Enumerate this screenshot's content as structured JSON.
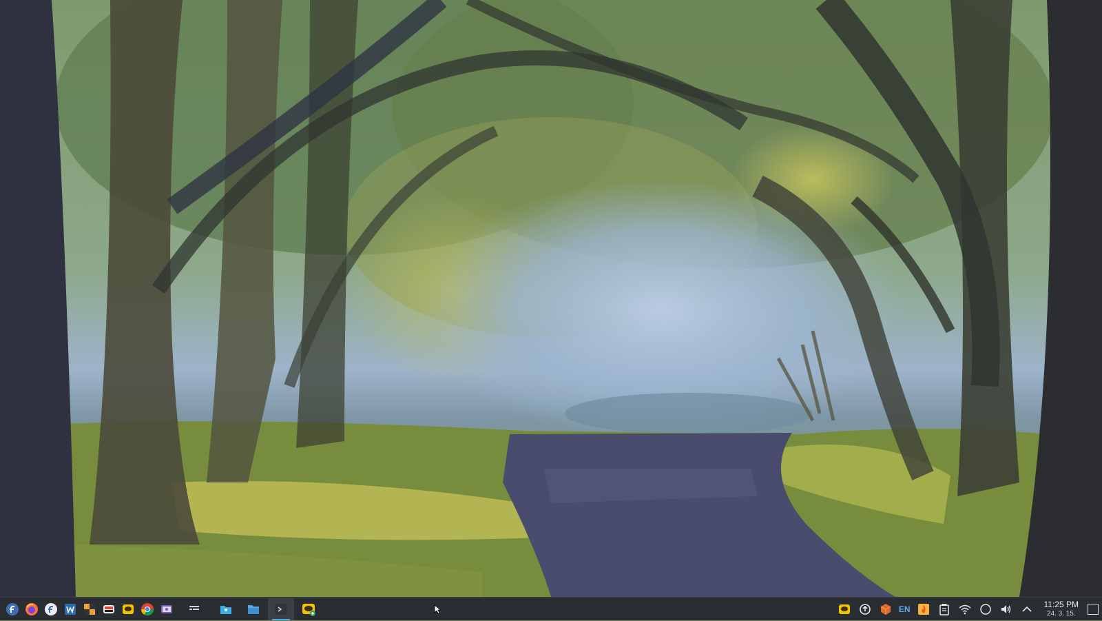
{
  "desktop": {
    "wallpaper": "painted-forest-path"
  },
  "taskbar": {
    "launchers": [
      {
        "name": "fedora-icon",
        "color": "#3c6eb4"
      },
      {
        "name": "firefox-icon",
        "color": "#ff7139"
      },
      {
        "name": "fedora-media-writer-icon",
        "color": "#6aa0d8"
      },
      {
        "name": "writer-icon",
        "color": "#2a6bb0"
      },
      {
        "name": "puzzle-game-icon",
        "color": "#e8a33d"
      },
      {
        "name": "sushi-app-icon",
        "color": "#d94a3a"
      },
      {
        "name": "chat-app-icon",
        "color": "#f2c400"
      },
      {
        "name": "chrome-icon",
        "color": "#4285f4"
      },
      {
        "name": "screenshot-app-icon",
        "color": "#7c5ea8"
      },
      {
        "name": "window-manager-icon",
        "color": "#cfd4d8"
      }
    ],
    "tasks": [
      {
        "name": "files-task-icon",
        "color": "#3daee9",
        "active": false
      },
      {
        "name": "folder-task-icon",
        "color": "#5aa9e6",
        "active": false
      },
      {
        "name": "terminal-task-icon",
        "color": "#9aa0a6",
        "active": true
      },
      {
        "name": "chat-add-task-icon",
        "color": "#f2c400",
        "active": false
      }
    ],
    "tray": {
      "chat_indicator_icon": "chat-tray-icon",
      "update_icon": "update-tray-icon",
      "package_icon": "package-tray-icon",
      "language": "EN",
      "flame_icon": "flame-tray-icon",
      "clipboard_icon": "clipboard-tray-icon",
      "wifi_icon": "wifi-icon",
      "night_light_icon": "night-light-icon",
      "volume_icon": "volume-icon",
      "expand_icon": "chevron-up-icon",
      "clock_time": "11:25 PM",
      "clock_date": "24. 3. 15.",
      "show_desktop_icon": "show-desktop-icon"
    }
  }
}
